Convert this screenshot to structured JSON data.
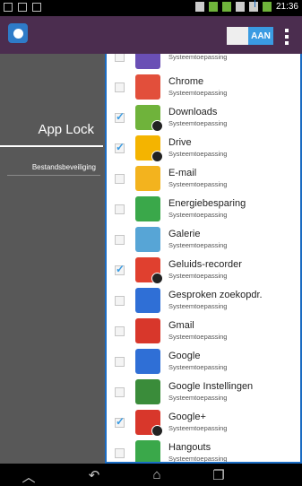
{
  "status_bar": {
    "time": "21:36"
  },
  "action_bar": {
    "toggle_label": "AAN"
  },
  "drawer": {
    "title": "App Lock",
    "items": [
      {
        "label": "Bestandsbeveiliging"
      }
    ]
  },
  "apps": [
    {
      "name": "",
      "sub": "Systeemtoepassing",
      "checked": false,
      "icon": "unknown-app-icon",
      "color": "#6a4fb5",
      "locked": false
    },
    {
      "name": "Chrome",
      "sub": "Systeemtoepassing",
      "checked": false,
      "icon": "chrome-icon",
      "color": "#e24f3b",
      "locked": false
    },
    {
      "name": "Downloads",
      "sub": "Systeemtoepassing",
      "checked": true,
      "icon": "downloads-icon",
      "color": "#6fb33b",
      "locked": true
    },
    {
      "name": "Drive",
      "sub": "Systeemtoepassing",
      "checked": true,
      "icon": "drive-icon",
      "color": "#f4b400",
      "locked": true
    },
    {
      "name": "E-mail",
      "sub": "Systeemtoepassing",
      "checked": false,
      "icon": "email-icon",
      "color": "#f3b31e",
      "locked": false
    },
    {
      "name": "Energiebesparing",
      "sub": "Systeemtoepassing",
      "checked": false,
      "icon": "battery-icon",
      "color": "#3aa84a",
      "locked": false
    },
    {
      "name": "Galerie",
      "sub": "Systeemtoepassing",
      "checked": false,
      "icon": "gallery-icon",
      "color": "#57a5d6",
      "locked": false
    },
    {
      "name": "Geluids-recorder",
      "sub": "Systeemtoepassing",
      "checked": true,
      "icon": "recorder-icon",
      "color": "#e0402f",
      "locked": true
    },
    {
      "name": "Gesproken zoekopdr.",
      "sub": "Systeemtoepassing",
      "checked": false,
      "icon": "voice-search-icon",
      "color": "#2f6fd6",
      "locked": false
    },
    {
      "name": "Gmail",
      "sub": "Systeemtoepassing",
      "checked": false,
      "icon": "gmail-icon",
      "color": "#d8372b",
      "locked": false
    },
    {
      "name": "Google",
      "sub": "Systeemtoepassing",
      "checked": false,
      "icon": "google-icon",
      "color": "#2f6fd6",
      "locked": false
    },
    {
      "name": "Google Instellingen",
      "sub": "Systeemtoepassing",
      "checked": false,
      "icon": "google-settings-icon",
      "color": "#3a8c3a",
      "locked": false
    },
    {
      "name": "Google+",
      "sub": "Systeemtoepassing",
      "checked": true,
      "icon": "google-plus-icon",
      "color": "#d8372b",
      "locked": true
    },
    {
      "name": "Hangouts",
      "sub": "Systeemtoepassing",
      "checked": false,
      "icon": "hangouts-icon",
      "color": "#3aa84a",
      "locked": false
    }
  ]
}
